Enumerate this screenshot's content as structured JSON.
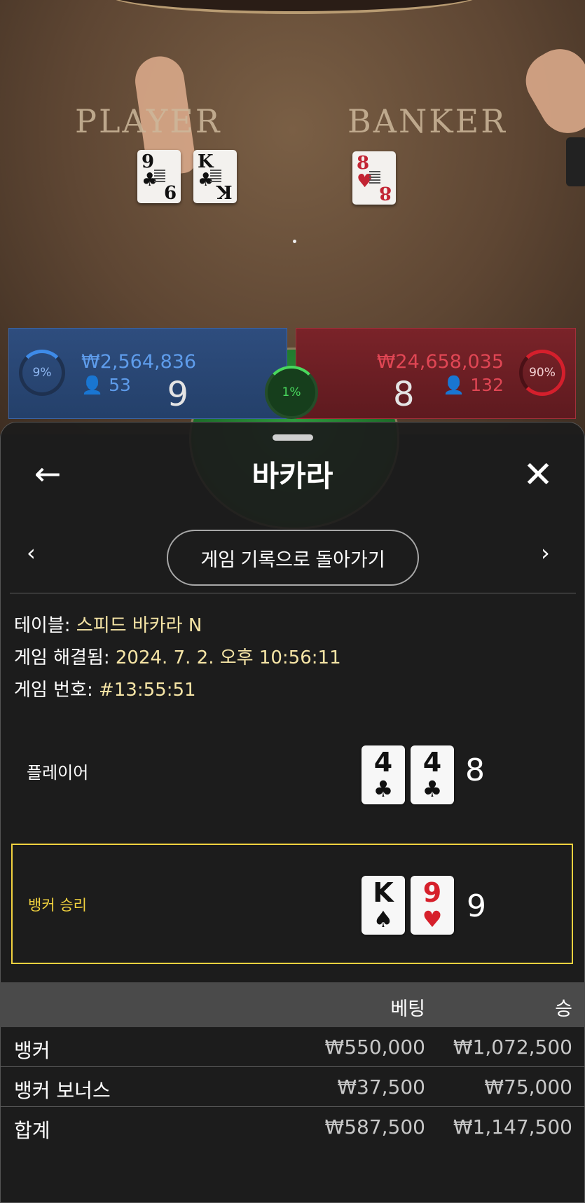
{
  "background": {
    "felt_player": "PLAYER",
    "felt_banker": "BANKER",
    "table_cards": [
      {
        "rank": "9",
        "suit": "♣"
      },
      {
        "rank": "K",
        "suit": "♣"
      },
      {
        "rank": "8",
        "suit": "♥"
      }
    ],
    "player_bar": {
      "percent": "9%",
      "amount": "₩2,564,836",
      "players": "53",
      "score": "9"
    },
    "tie": {
      "percent": "1%"
    },
    "banker_bar": {
      "percent": "90%",
      "amount": "₩24,658,035",
      "players": "132",
      "score": "8"
    }
  },
  "header": {
    "title": "바카라",
    "back_icon": "←",
    "close_icon": "✕"
  },
  "nav": {
    "prev": "‹",
    "next": "›",
    "button_label": "게임 기록으로 돌아가기"
  },
  "info": {
    "table_label": "테이블:",
    "table_value": "스피드 바카라 N",
    "resolved_label": "게임 해결됨:",
    "resolved_value": "2024. 7. 2. 오후 10:56:11",
    "number_label": "게임 번호:",
    "number_value": "#13:55:51"
  },
  "hands": {
    "player": {
      "label": "플레이어",
      "cards": [
        {
          "rank": "4",
          "suit": "♣",
          "color": "black"
        },
        {
          "rank": "4",
          "suit": "♣",
          "color": "black"
        }
      ],
      "total": "8"
    },
    "banker": {
      "label": "뱅커 승리",
      "cards": [
        {
          "rank": "K",
          "suit": "♠",
          "color": "black"
        },
        {
          "rank": "9",
          "suit": "♥",
          "color": "red"
        }
      ],
      "total": "9"
    }
  },
  "bets_table": {
    "headers": {
      "bet": "베팅",
      "win": "승"
    },
    "rows": [
      {
        "name": "뱅커",
        "bet": "₩550,000",
        "win": "₩1,072,500"
      },
      {
        "name": "뱅커 보너스",
        "bet": "₩37,500",
        "win": "₩75,000"
      },
      {
        "name": "합계",
        "bet": "₩587,500",
        "win": "₩1,147,500"
      }
    ]
  },
  "colors": {
    "highlight": "#f1d23f",
    "player_blue": "#5e9ceb",
    "banker_red": "#e04654",
    "tie_green": "#49d85d"
  }
}
